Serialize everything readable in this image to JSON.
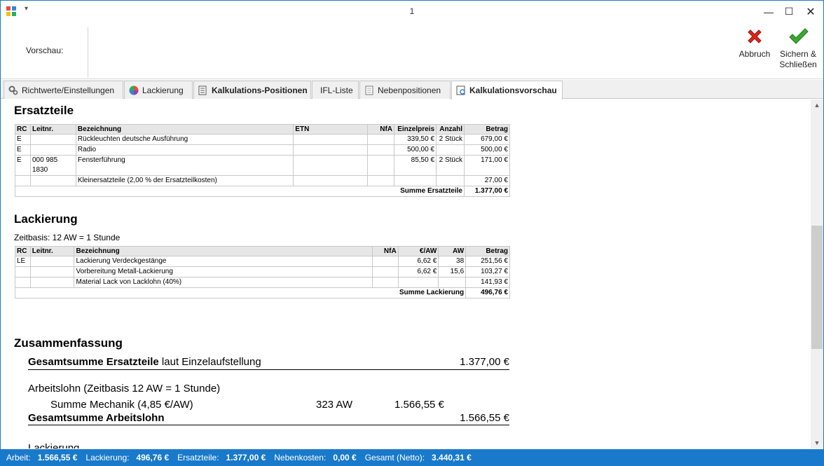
{
  "window": {
    "title": "1"
  },
  "ribbon": {
    "preview_label": "Vorschau:",
    "cancel_label": "Abbruch",
    "save_label_line1": "Sichern &",
    "save_label_line2": "Schließen"
  },
  "tabs": [
    {
      "label": "Richtwerte/Einstellungen"
    },
    {
      "label": "Lackierung"
    },
    {
      "label": "Kalkulations-Positionen"
    },
    {
      "label": "IFL-Liste"
    },
    {
      "label": "Nebenpositionen"
    },
    {
      "label": "Kalkulationsvorschau"
    }
  ],
  "ersatzteile": {
    "heading": "Ersatzteile",
    "columns": [
      "RC",
      "Leitnr.",
      "Bezeichnung",
      "ETN",
      "NfA",
      "Einzelpreis",
      "Anzahl",
      "Betrag"
    ],
    "rows": [
      {
        "rc": "E",
        "leitnr": "",
        "bez": "Rückleuchten deutsche Ausführung",
        "etn": "",
        "nfa": "",
        "preis": "339,50 €",
        "anzahl": "2 Stück",
        "betrag": "679,00 €"
      },
      {
        "rc": "E",
        "leitnr": "",
        "bez": "Radio",
        "etn": "",
        "nfa": "",
        "preis": "500,00 €",
        "anzahl": "",
        "betrag": "500,00 €"
      },
      {
        "rc": "E",
        "leitnr": "000 985 1830",
        "bez": "Fensterführung",
        "etn": "",
        "nfa": "",
        "preis": "85,50 €",
        "anzahl": "2 Stück",
        "betrag": "171,00 €"
      },
      {
        "rc": "",
        "leitnr": "",
        "bez": "Kleinersatzteile (2,00 % der Ersatzteilkosten)",
        "etn": "",
        "nfa": "",
        "preis": "",
        "anzahl": "",
        "betrag": "27,00 €"
      }
    ],
    "sum_label": "Summe Ersatzteile",
    "sum_value": "1.377,00 €"
  },
  "lackierung": {
    "heading": "Lackierung",
    "zeitbasis": "Zeitbasis:  12 AW = 1 Stunde",
    "columns": [
      "RC",
      "Leitnr.",
      "Bezeichnung",
      "NfA",
      "€/AW",
      "AW",
      "Betrag"
    ],
    "rows": [
      {
        "rc": "LE",
        "leitnr": "",
        "bez": "Lackierung Verdeckgestänge",
        "nfa": "",
        "eur_aw": "6,62 €",
        "aw": "38",
        "betrag": "251,56 €"
      },
      {
        "rc": "",
        "leitnr": "",
        "bez": "Vorbereitung Metall-Lackierung",
        "nfa": "",
        "eur_aw": "6,62 €",
        "aw": "15,6",
        "betrag": "103,27 €"
      },
      {
        "rc": "",
        "leitnr": "",
        "bez": "Material Lack von Lacklohn (40%)",
        "nfa": "",
        "eur_aw": "",
        "aw": "",
        "betrag": "141,93 €"
      }
    ],
    "sum_label": "Summe Lackierung",
    "sum_value": "496,76 €"
  },
  "zusammenfassung": {
    "heading": "Zusammenfassung",
    "ges_ersatz_bold": "Gesamtsumme Ersatzteile",
    "ges_ersatz_rest": " laut Einzelaufstellung",
    "ges_ersatz_value": "1.377,00 €",
    "arbeitslohn_label": "Arbeitslohn (Zeitbasis 12 AW = 1 Stunde)",
    "mechanik_label": "Summe Mechanik  (4,85 €/AW)",
    "mechanik_aw": "323 AW",
    "mechanik_value": "1.566,55 €",
    "ges_arbeitslohn_label": "Gesamtsumme Arbeitslohn",
    "ges_arbeitslohn_value": "1.566,55 €",
    "next_heading_partial": "Lackierung"
  },
  "status": {
    "arbeit_label": "Arbeit:",
    "arbeit_value": "1.566,55 €",
    "lack_label": "Lackierung:",
    "lack_value": "496,76 €",
    "ersatz_label": "Ersatzteile:",
    "ersatz_value": "1.377,00 €",
    "neben_label": "Nebenkosten:",
    "neben_value": "0,00 €",
    "gesamt_label": "Gesamt (Netto):",
    "gesamt_value": "3.440,31 €"
  },
  "colors": {
    "accent": "#1979ca",
    "cancel": "#d9261c",
    "save": "#3aa832"
  }
}
